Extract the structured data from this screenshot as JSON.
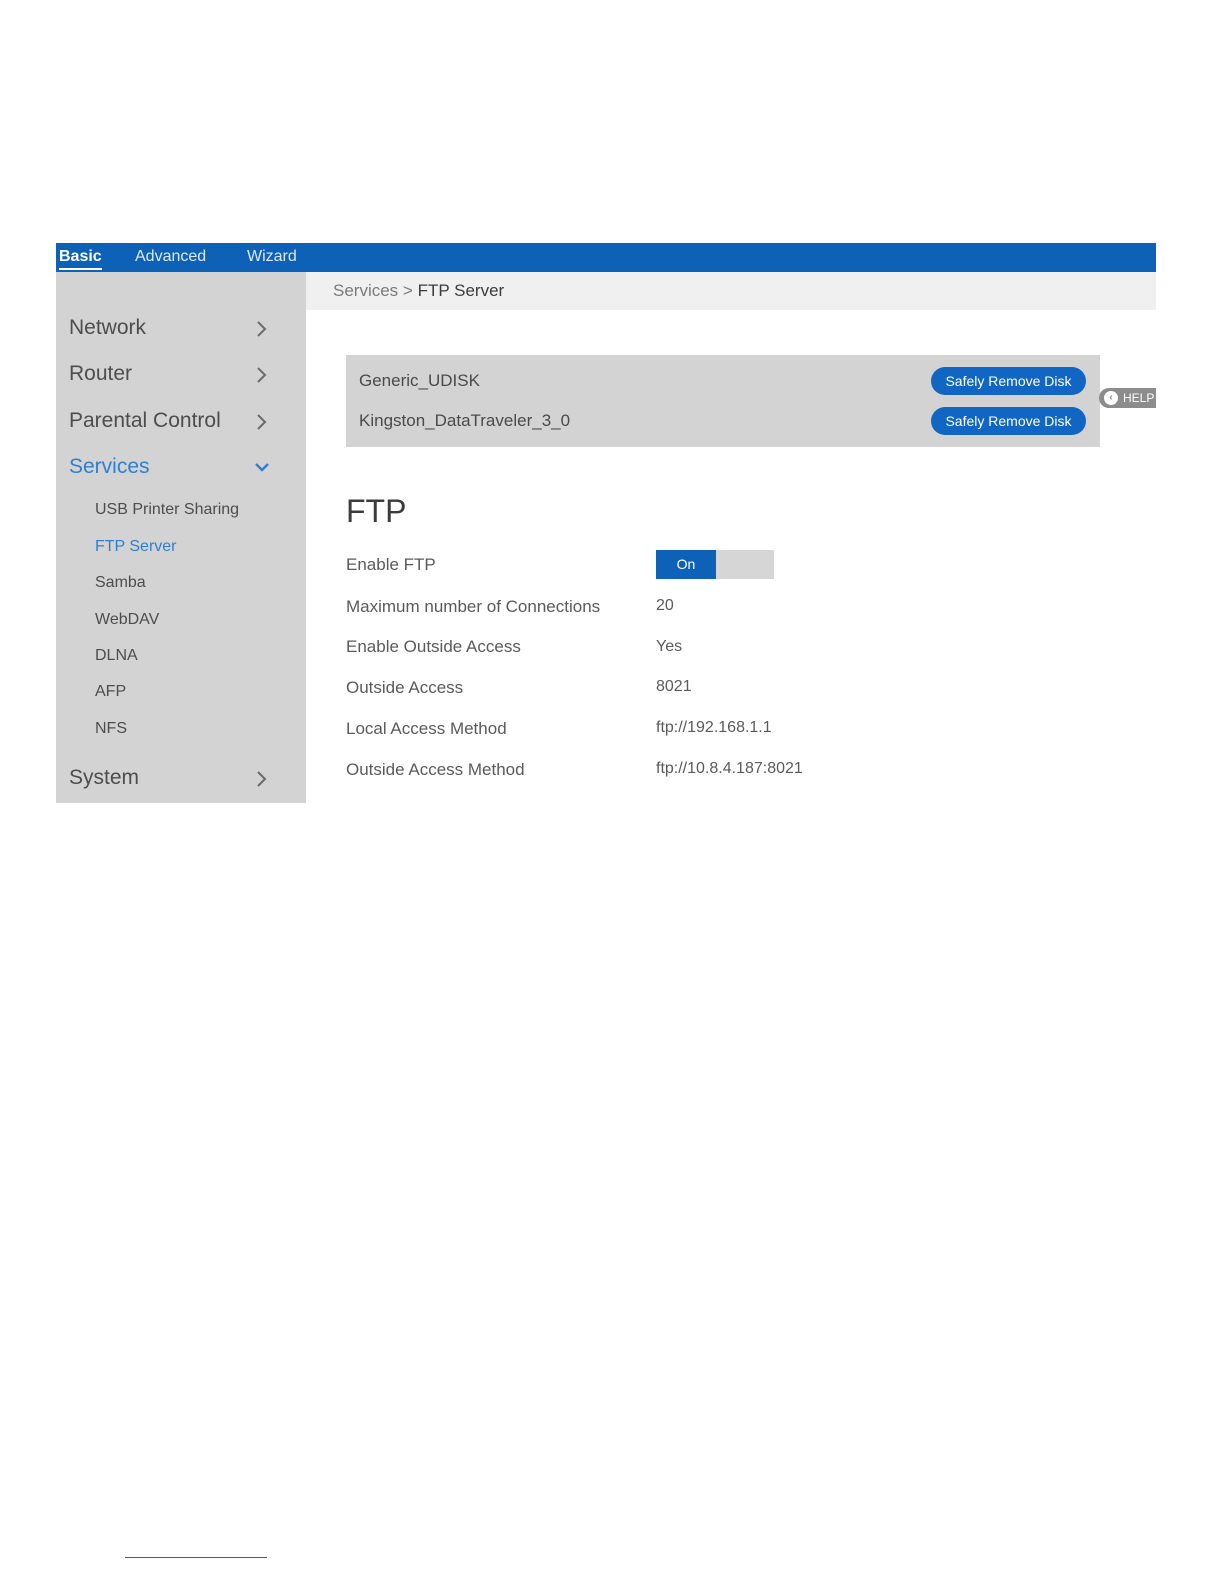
{
  "topbar": {
    "tabs": [
      {
        "label": "Basic",
        "active": true
      },
      {
        "label": "Advanced",
        "active": false
      },
      {
        "label": "Wizard",
        "active": false
      }
    ]
  },
  "sidebar": {
    "items": [
      {
        "label": "Network",
        "icon": "chevron-right-icon"
      },
      {
        "label": "Router",
        "icon": "chevron-right-icon"
      },
      {
        "label": "Parental Control",
        "icon": "chevron-right-icon"
      },
      {
        "label": "Services",
        "icon": "chevron-down-icon",
        "expanded": true
      },
      {
        "label": "System",
        "icon": "chevron-right-icon"
      }
    ],
    "services_subitems": [
      {
        "label": "USB Printer Sharing"
      },
      {
        "label": "FTP Server",
        "active": true
      },
      {
        "label": "Samba"
      },
      {
        "label": "WebDAV"
      },
      {
        "label": "DLNA"
      },
      {
        "label": "AFP"
      },
      {
        "label": "NFS"
      }
    ]
  },
  "breadcrumb": {
    "parent": "Services",
    "separator": ">",
    "current": "FTP Server"
  },
  "disks": [
    {
      "name": "Generic_UDISK",
      "button": "Safely Remove Disk"
    },
    {
      "name": "Kingston_DataTraveler_3_0",
      "button": "Safely Remove Disk"
    }
  ],
  "help": {
    "label": "HELP",
    "icon": "chevron-left-icon"
  },
  "ftp": {
    "title": "FTP",
    "enable_label": "Enable FTP",
    "enable_state": "On",
    "fields": [
      {
        "label": "Maximum number of Connections",
        "value": "20"
      },
      {
        "label": "Enable Outside Access",
        "value": "Yes"
      },
      {
        "label": "Outside Access",
        "value": "8021"
      },
      {
        "label": "Local Access Method",
        "value": "ftp://192.168.1.1"
      },
      {
        "label": "Outside Access Method",
        "value": "ftp://10.8.4.187:8021"
      }
    ]
  },
  "colors": {
    "brand": "#0d62b8",
    "accent_text": "#2f7fd0",
    "sidebar_bg": "#d3d3d3"
  }
}
